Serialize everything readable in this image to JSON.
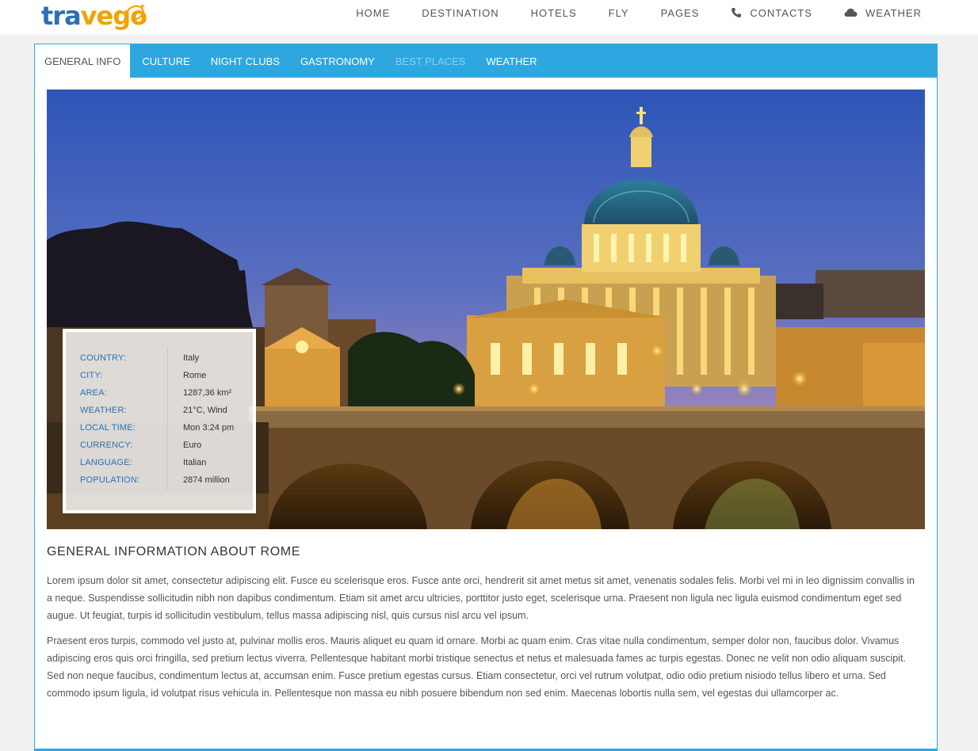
{
  "brand": {
    "part1": "tra",
    "part2": "vego"
  },
  "topnav": {
    "items": [
      {
        "label": "HOME"
      },
      {
        "label": "DESTINATION"
      },
      {
        "label": "HOTELS"
      },
      {
        "label": "FLY"
      },
      {
        "label": "PAGES"
      },
      {
        "label": "CONTACTS",
        "icon": "phone-icon"
      },
      {
        "label": "WEATHER",
        "icon": "cloud-icon"
      }
    ]
  },
  "tabs": [
    {
      "label": "GENERAL INFO",
      "state": "active"
    },
    {
      "label": "CULTURE",
      "state": "normal"
    },
    {
      "label": "NIGHT CLUBS",
      "state": "normal"
    },
    {
      "label": "GASTRONOMY",
      "state": "normal"
    },
    {
      "label": "BEST PLACES",
      "state": "disabled"
    },
    {
      "label": "WEATHER",
      "state": "normal"
    }
  ],
  "info": [
    {
      "key": "COUNTRY:",
      "value": "Italy"
    },
    {
      "key": "CITY:",
      "value": "Rome"
    },
    {
      "key": "AREA:",
      "value": "1287,36 km²"
    },
    {
      "key": "WEATHER:",
      "value": "21°C, Wind"
    },
    {
      "key": "LOCAL TIME:",
      "value": "Mon 3:24 pm"
    },
    {
      "key": "CURRENCY:",
      "value": "Euro"
    },
    {
      "key": "LANGUAGE:",
      "value": "Italian"
    },
    {
      "key": "POPULATION:",
      "value": "2874 million"
    }
  ],
  "article": {
    "title": "GENERAL INFORMATION ABOUT ROME",
    "paragraphs": [
      "Lorem ipsum dolor sit amet, consectetur adipiscing elit. Fusce eu scelerisque eros. Fusce ante orci, hendrerit sit amet metus sit amet, venenatis sodales felis. Morbi vel mi in leo dignissim convallis in a neque. Suspendisse sollicitudin nibh non dapibus condimentum. Etiam sit amet arcu ultricies, porttitor justo eget, scelerisque urna. Praesent non ligula nec ligula euismod condimentum eget sed augue. Ut feugiat, turpis id sollicitudin vestibulum, tellus massa adipiscing nisl, quis cursus nisl arcu vel ipsum.",
      "Praesent eros turpis, commodo vel justo at, pulvinar mollis eros. Mauris aliquet eu quam id ornare. Morbi ac quam enim. Cras vitae nulla condimentum, semper dolor non, faucibus dolor. Vivamus adipiscing eros quis orci fringilla, sed pretium lectus viverra. Pellentesque habitant morbi tristique senectus et netus et malesuada fames ac turpis egestas. Donec ne velit non odio aliquam suscipit. Sed non neque faucibus, condimentum lectus at, accumsan enim. Fusce pretium egestas cursus. Etiam consectetur, orci vel rutrum volutpat, odio odio pretium nisiodo tellus libero et urna. Sed commodo ipsum ligula, id volutpat risus vehicula in. Pellentesque non massa eu nibh posuere bibendum non sed enim. Maecenas lobortis nulla sem, vel egestas dui ullamcorper ac."
    ]
  },
  "colors": {
    "accent": "#2ea7e0",
    "brand_blue": "#2b6fb6",
    "brand_orange": "#f0a400"
  }
}
